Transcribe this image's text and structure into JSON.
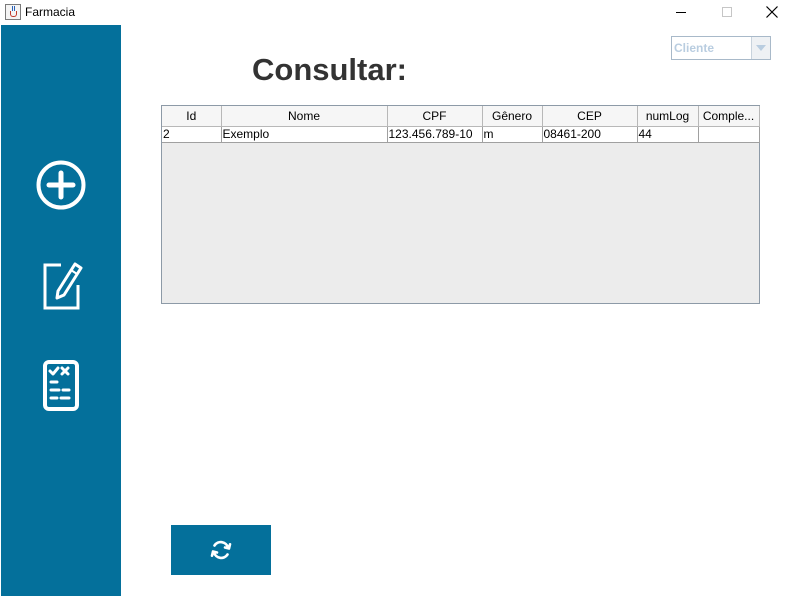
{
  "window": {
    "title": "Farmacia"
  },
  "header": {
    "title": "Consultar:"
  },
  "filter": {
    "selected": "Cliente"
  },
  "table": {
    "columns": [
      "Id",
      "Nome",
      "CPF",
      "Gênero",
      "CEP",
      "numLog",
      "Comple..."
    ],
    "rows": [
      [
        "2",
        "Exemplo",
        "123.456.789-10",
        "m",
        "08461-200",
        "44",
        ""
      ]
    ]
  },
  "sidebar": {
    "icons": [
      "add-circle-icon",
      "edit-document-icon",
      "checklist-icon"
    ]
  },
  "colors": {
    "sidebar": "#04709b",
    "accent": "#04709b",
    "title": "#333333"
  },
  "actions": {
    "refresh_icon": "refresh-icon"
  }
}
